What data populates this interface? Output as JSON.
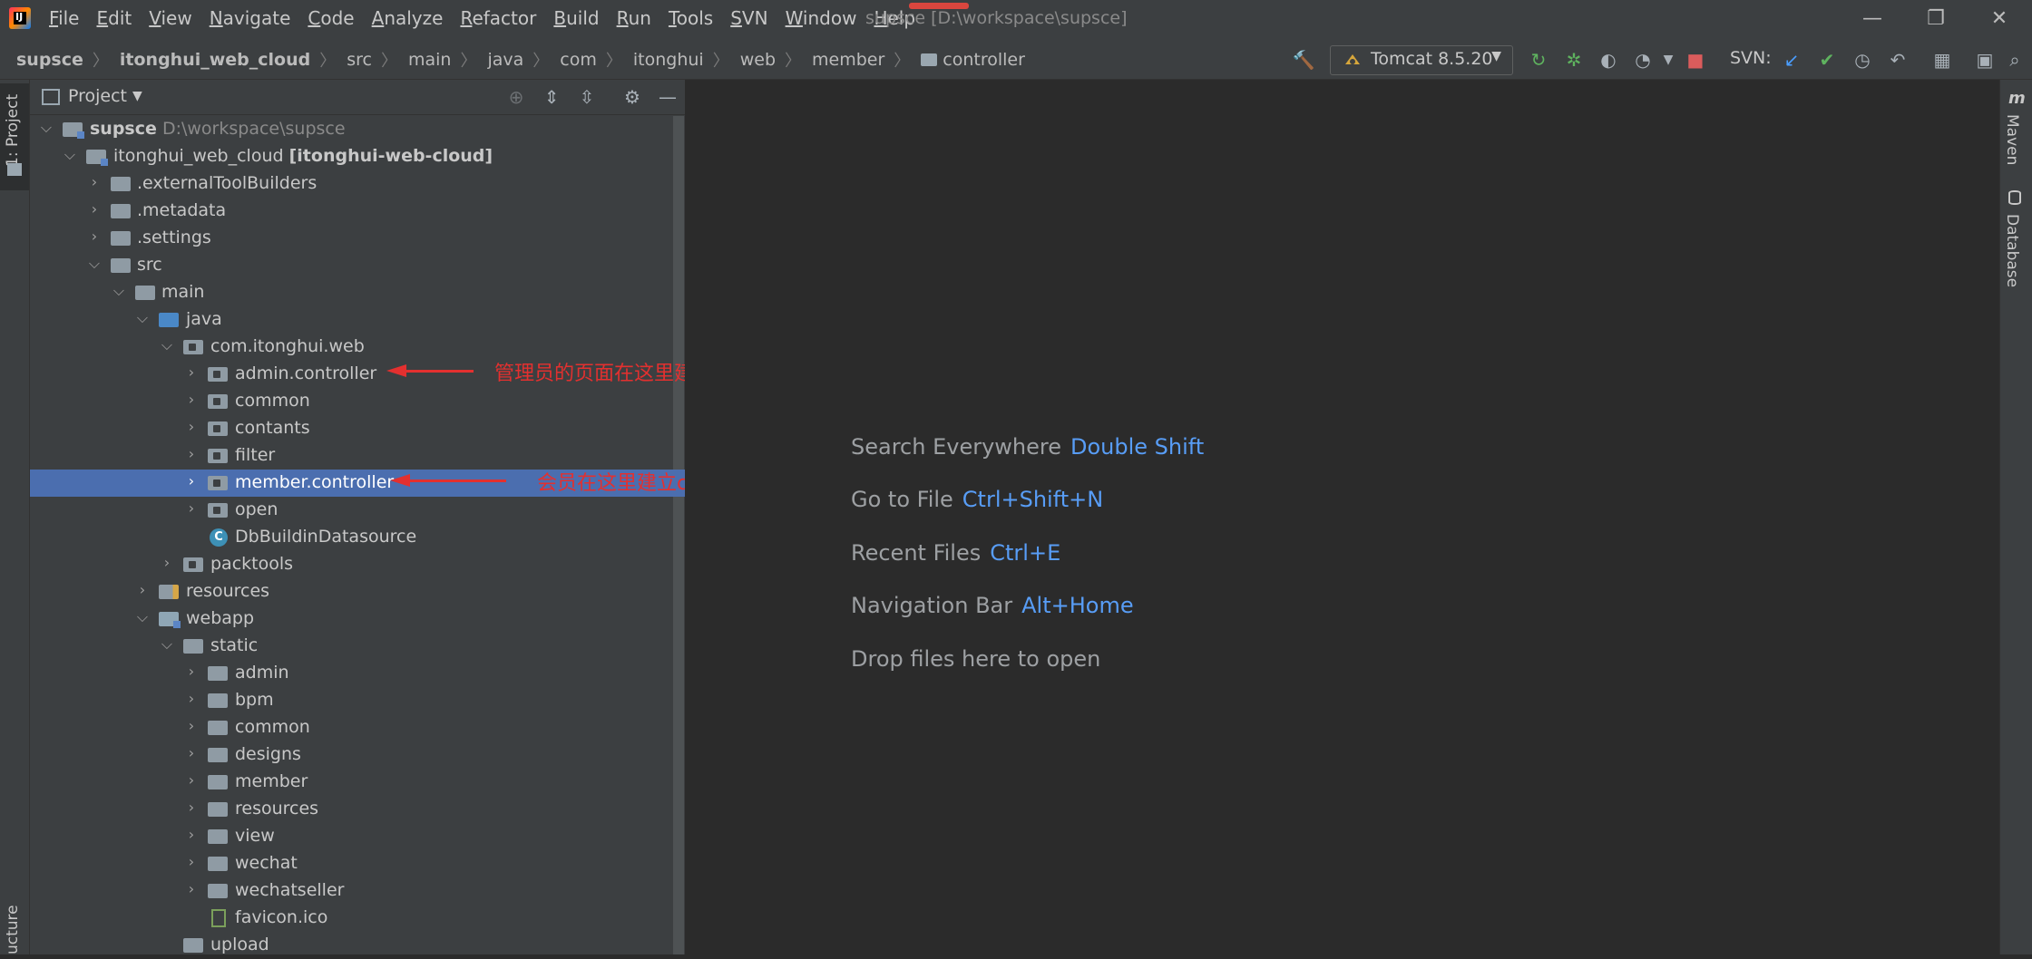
{
  "menu": [
    "File",
    "Edit",
    "View",
    "Navigate",
    "Code",
    "Analyze",
    "Refactor",
    "Build",
    "Run",
    "Tools",
    "SVN",
    "Window",
    "Help"
  ],
  "window_title": "supsce [D:\\workspace\\supsce]",
  "window_controls": {
    "minimize": "—",
    "restore": "❐",
    "close": "✕"
  },
  "breadcrumbs": [
    "supsce",
    "itonghui_web_cloud",
    "src",
    "main",
    "java",
    "com",
    "itonghui",
    "web",
    "member",
    "controller"
  ],
  "run_config": "Tomcat 8.5.20",
  "svn_label": "SVN:",
  "left_tabs": {
    "project": "1: Project",
    "structure": "ucture"
  },
  "right_tabs": {
    "maven": "Maven",
    "database": "Database"
  },
  "panel": {
    "title": "Project"
  },
  "tree": [
    {
      "label": "supsce",
      "extra": "D:\\workspace\\supsce"
    },
    {
      "label": "itonghui_web_cloud",
      "extra": "[itonghui-web-cloud]"
    },
    {
      "label": ".externalToolBuilders"
    },
    {
      "label": ".metadata"
    },
    {
      "label": ".settings"
    },
    {
      "label": "src"
    },
    {
      "label": "main"
    },
    {
      "label": "java"
    },
    {
      "label": "com.itonghui.web"
    },
    {
      "label": "admin.controller"
    },
    {
      "label": "common"
    },
    {
      "label": "contants"
    },
    {
      "label": "filter"
    },
    {
      "label": "member.controller"
    },
    {
      "label": "open"
    },
    {
      "label": "DbBuildinDatasource"
    },
    {
      "label": "packtools"
    },
    {
      "label": "resources"
    },
    {
      "label": "webapp"
    },
    {
      "label": "static"
    },
    {
      "label": "admin"
    },
    {
      "label": "bpm"
    },
    {
      "label": "common"
    },
    {
      "label": "designs"
    },
    {
      "label": "member"
    },
    {
      "label": "resources"
    },
    {
      "label": "view"
    },
    {
      "label": "wechat"
    },
    {
      "label": "wechatseller"
    },
    {
      "label": "favicon.ico"
    },
    {
      "label": "upload"
    }
  ],
  "annotations": {
    "admin_note": "管理员的页面在这里建立ctl",
    "member_note": "会员在这里建立ctl",
    "color": "#e3302f"
  },
  "editor_hints": [
    {
      "text": "Search Everywhere",
      "key": "Double Shift"
    },
    {
      "text": "Go to File",
      "key": "Ctrl+Shift+N"
    },
    {
      "text": "Recent Files",
      "key": "Ctrl+E"
    },
    {
      "text": "Navigation Bar",
      "key": "Alt+Home"
    },
    {
      "text": "Drop files here to open",
      "key": ""
    }
  ],
  "colors": {
    "selection": "#4b6eaf",
    "hint_key": "#589df6",
    "background": "#2b2b2b"
  }
}
